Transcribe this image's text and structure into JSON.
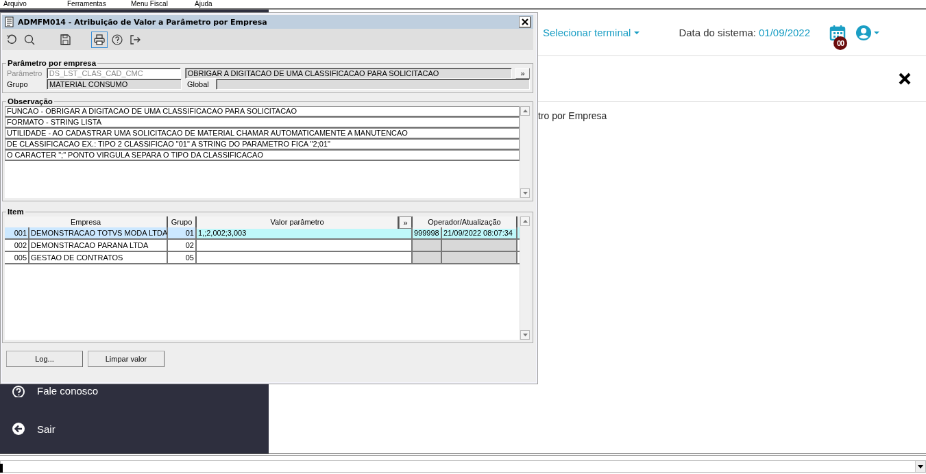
{
  "menu_bar": [
    "Arquivo",
    "Ferramentas",
    "Menu Fiscal",
    "Ajuda"
  ],
  "header": {
    "terminal": "Selecionar terminal",
    "date_label": "Data do sistema:",
    "date_value": "01/09/2022",
    "badge": "00"
  },
  "page_title_fragment": "tro por Empresa",
  "sidebar": {
    "items": [
      {
        "label": "Fale conosco",
        "kind": "help"
      },
      {
        "label": "Sair",
        "kind": "exit"
      }
    ]
  },
  "dialog": {
    "title": "ADMFM014 - Atribuição de Valor a Parâmetro por Empresa",
    "toolbar": [
      {
        "kind": "undo",
        "selected": false
      },
      {
        "kind": "search",
        "selected": false
      },
      {
        "kind": "save",
        "selected": false
      },
      {
        "kind": "print",
        "selected": true
      },
      {
        "kind": "help",
        "selected": false
      },
      {
        "kind": "exit",
        "selected": false
      }
    ],
    "parameter_group": {
      "title": "Parâmetro por empresa",
      "param_label": "Parâmetro",
      "param_value": "DS_LST_CLAS_CAD_CMC",
      "param_disabled": true,
      "description": "OBRIGAR A DIGITACAO DE UMA CLASSIFICACAO PARA SOLICITACAO",
      "more_button": "»",
      "group_label": "Grupo",
      "group_value": "MATERIAL CONSUMO",
      "global_label": "Global"
    },
    "observation": {
      "title": "Observação",
      "lines": [
        "FUNCAO - OBRIGAR A DIGITACAO DE UMA CLASSIFICACAO PARA SOLICITACAO",
        "FORMATO - STRING LISTA",
        "UTILIDADE - AO CADASTRAR UMA SOLICITACAO DE MATERIAL CHAMAR AUTOMATICAMENTE A MANUTENCAO",
        "DE CLASSIFICACAO EX.: TIPO 2 CLASSIFICAO \"01\" A STRING DO PARAMETRO FICA \"2;01\"",
        "O CARACTER \";\" PONTO VIRGULA SEPARA O TIPO DA CLASSIFICACAO"
      ]
    },
    "items": {
      "title": "Item",
      "columns": [
        "Empresa",
        "Grupo",
        "Valor parâmetro",
        "»",
        "Operador/Atualização"
      ],
      "rows": [
        {
          "code": "001",
          "company": "DEMONSTRACAO TOTVS MODA LTDA",
          "group": "01",
          "value": "1,;2,002;3,003",
          "operator": "999998",
          "updated": "21/09/2022 08:07:34",
          "selected": true
        },
        {
          "code": "002",
          "company": "DEMONSTRACAO PARANA LTDA",
          "group": "02",
          "selected": false
        },
        {
          "code": "005",
          "company": "GESTAO DE CONTRATOS",
          "group": "05",
          "selected": false
        }
      ]
    },
    "buttons": [
      "Log...",
      "Limpar valor"
    ]
  }
}
